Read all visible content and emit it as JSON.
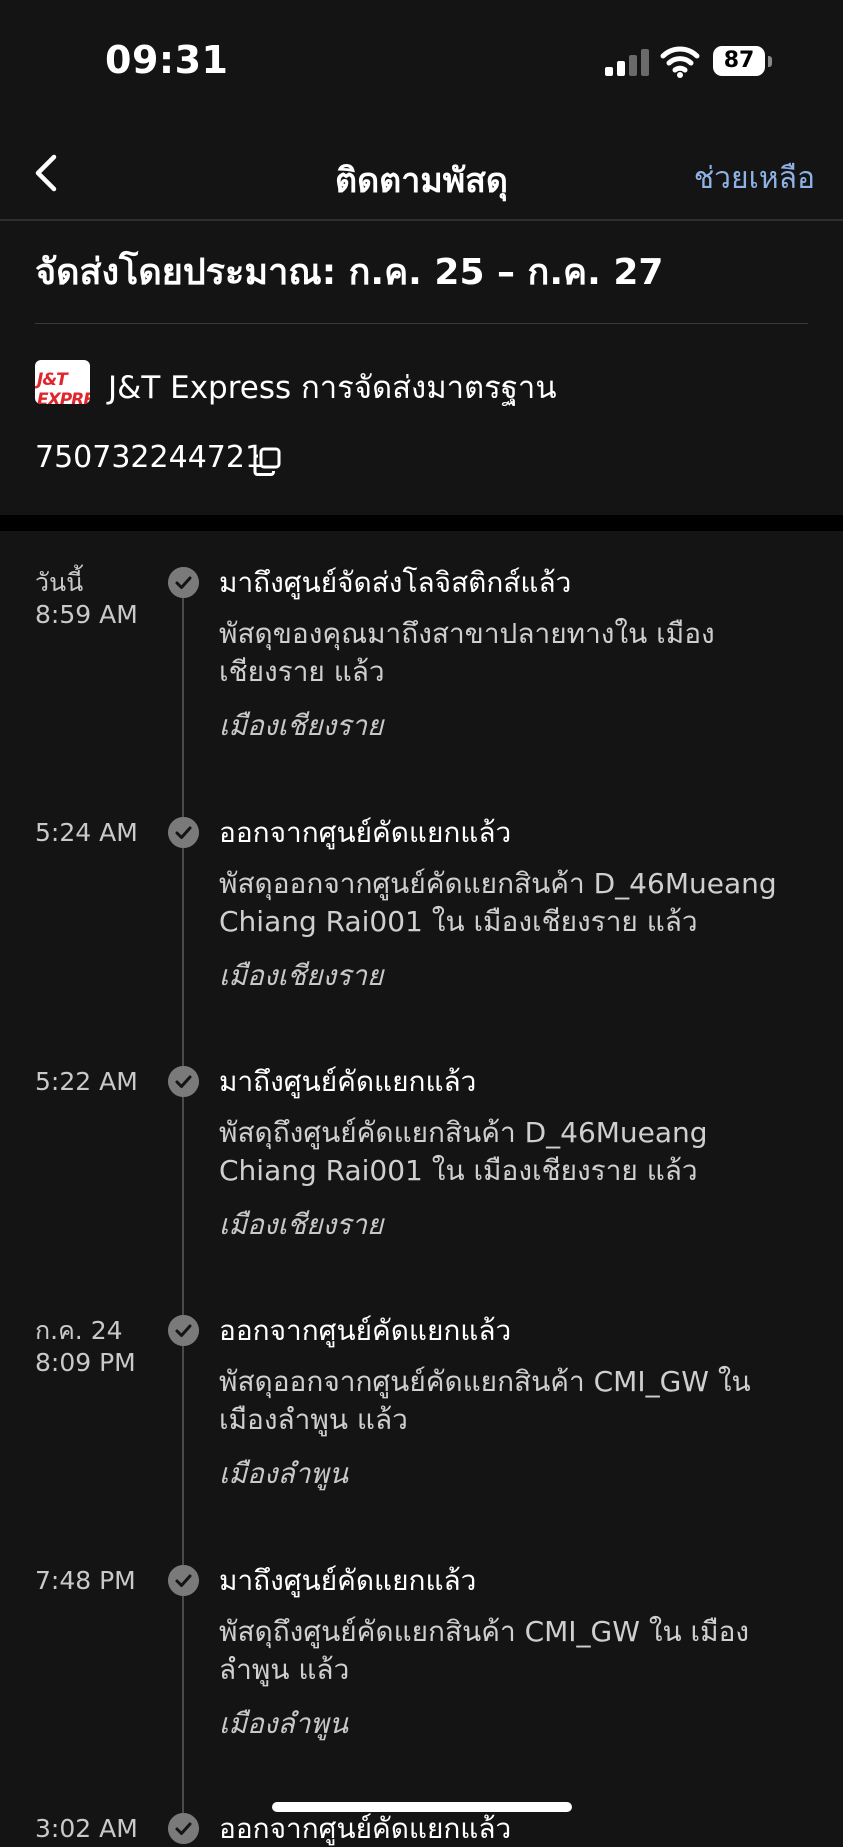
{
  "status_bar": {
    "time": "09:31",
    "battery": "87"
  },
  "nav": {
    "back_icon": "chevron-left-icon",
    "title": "ติดตามพัสดุ",
    "help": "ช่วยเหลือ"
  },
  "estimate": "จัดส่งโดยประมาณ: ก.ค. 25 – ก.ค. 27",
  "carrier": {
    "logo_text": "J&T EXPRESS",
    "name": "J&T Express การจัดส่งมาตรฐาน"
  },
  "tracking_number": "750732244721",
  "colors": {
    "background": "#141414",
    "accent_link": "#8fb2e6",
    "logo_red": "#e0262d"
  },
  "events": [
    {
      "date": "วันนี้",
      "time": "8:59 AM",
      "title": "มาถึงศูนย์จัดส่งโลจิสติกส์แล้ว",
      "description": "พัสดุของคุณมาถึงสาขาปลายทางใน เมืองเชียงราย แล้ว",
      "location": "เมืองเชียงราย"
    },
    {
      "date": "",
      "time": "5:24 AM",
      "title": "ออกจากศูนย์คัดแยกแล้ว",
      "description": "พัสดุออกจากศูนย์คัดแยกสินค้า D_46Mueang Chiang Rai001 ใน เมืองเชียงราย แล้ว",
      "location": "เมืองเชียงราย"
    },
    {
      "date": "",
      "time": "5:22 AM",
      "title": "มาถึงศูนย์คัดแยกแล้ว",
      "description": "พัสดุถึงศูนย์คัดแยกสินค้า D_46Mueang Chiang Rai001 ใน เมืองเชียงราย แล้ว",
      "location": "เมืองเชียงราย"
    },
    {
      "date": "ก.ค. 24",
      "time": "8:09 PM",
      "title": "ออกจากศูนย์คัดแยกแล้ว",
      "description": "พัสดุออกจากศูนย์คัดแยกสินค้า CMI_GW ใน เมืองลำพูน แล้ว",
      "location": "เมืองลำพูน"
    },
    {
      "date": "",
      "time": "7:48 PM",
      "title": "มาถึงศูนย์คัดแยกแล้ว",
      "description": "พัสดุถึงศูนย์คัดแยกสินค้า CMI_GW ใน เมืองลำพูน แล้ว",
      "location": "เมืองลำพูน"
    },
    {
      "date": "",
      "time": "3:02 AM",
      "title": "ออกจากศูนย์คัดแยกแล้ว",
      "description": "",
      "location": ""
    }
  ]
}
